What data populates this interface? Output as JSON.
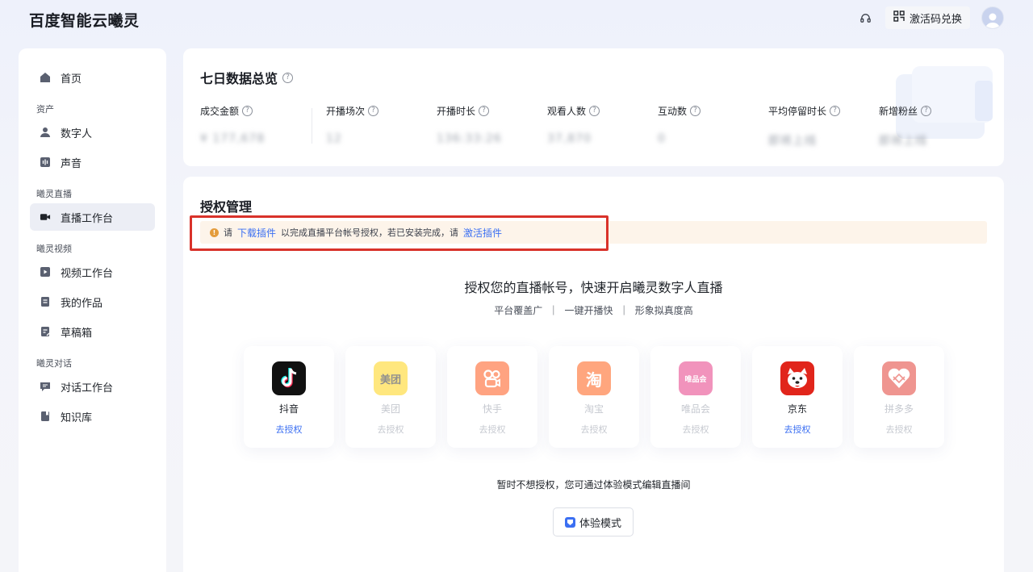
{
  "app": {
    "logo": "百度智能云曦灵"
  },
  "header": {
    "redeem_label": "激活码兑换"
  },
  "sidebar": {
    "home": "首页",
    "groups": [
      {
        "title": "资产",
        "items": [
          "数字人",
          "声音"
        ]
      },
      {
        "title": "曦灵直播",
        "items": [
          "直播工作台"
        ]
      },
      {
        "title": "曦灵视频",
        "items": [
          "视频工作台",
          "我的作品",
          "草稿箱"
        ]
      },
      {
        "title": "曦灵对话",
        "items": [
          "对话工作台",
          "知识库"
        ]
      }
    ],
    "active": "直播工作台"
  },
  "stats": {
    "title": "七日数据总览",
    "items": [
      {
        "label": "成交金额",
        "value": "¥ 177,678"
      },
      {
        "label": "开播场次",
        "value": "12"
      },
      {
        "label": "开播时长",
        "value": "136:33:26"
      },
      {
        "label": "观看人数",
        "value": "37,870"
      },
      {
        "label": "互动数",
        "value": "0"
      },
      {
        "label": "平均停留时长",
        "value": "即将上线"
      },
      {
        "label": "新增粉丝",
        "value": "即将上线"
      }
    ]
  },
  "auth": {
    "title": "授权管理",
    "alert": {
      "prefix": "请",
      "download_link": "下载插件",
      "middle": "以完成直播平台帐号授权，若已安装完成，请",
      "activate_link": "激活插件"
    },
    "headline": "授权您的直播帐号，快速开启曦灵数字人直播",
    "subline": "平台覆盖广  ｜  一键开播快  ｜  形象拟真度高",
    "platforms": [
      {
        "name": "抖音",
        "link": "去授权",
        "enabled": true,
        "color": "#111111"
      },
      {
        "name": "美团",
        "link": "去授权",
        "enabled": false,
        "color": "#ffd100",
        "logo_text": "美团"
      },
      {
        "name": "快手",
        "link": "去授权",
        "enabled": false,
        "color": "#ff4906"
      },
      {
        "name": "淘宝",
        "link": "去授权",
        "enabled": false,
        "color": "#ff5000",
        "logo_text": "淘"
      },
      {
        "name": "唯品会",
        "link": "去授权",
        "enabled": false,
        "color": "#e5297c",
        "logo_text": "唯品会"
      },
      {
        "name": "京东",
        "link": "去授权",
        "enabled": true,
        "color": "#e1251b"
      },
      {
        "name": "拼多多",
        "link": "去授权",
        "enabled": false,
        "color": "#e02e24"
      }
    ],
    "later_text": "暂时不想授权，您可通过体验模式编辑直播间",
    "trial_label": "体验模式"
  }
}
